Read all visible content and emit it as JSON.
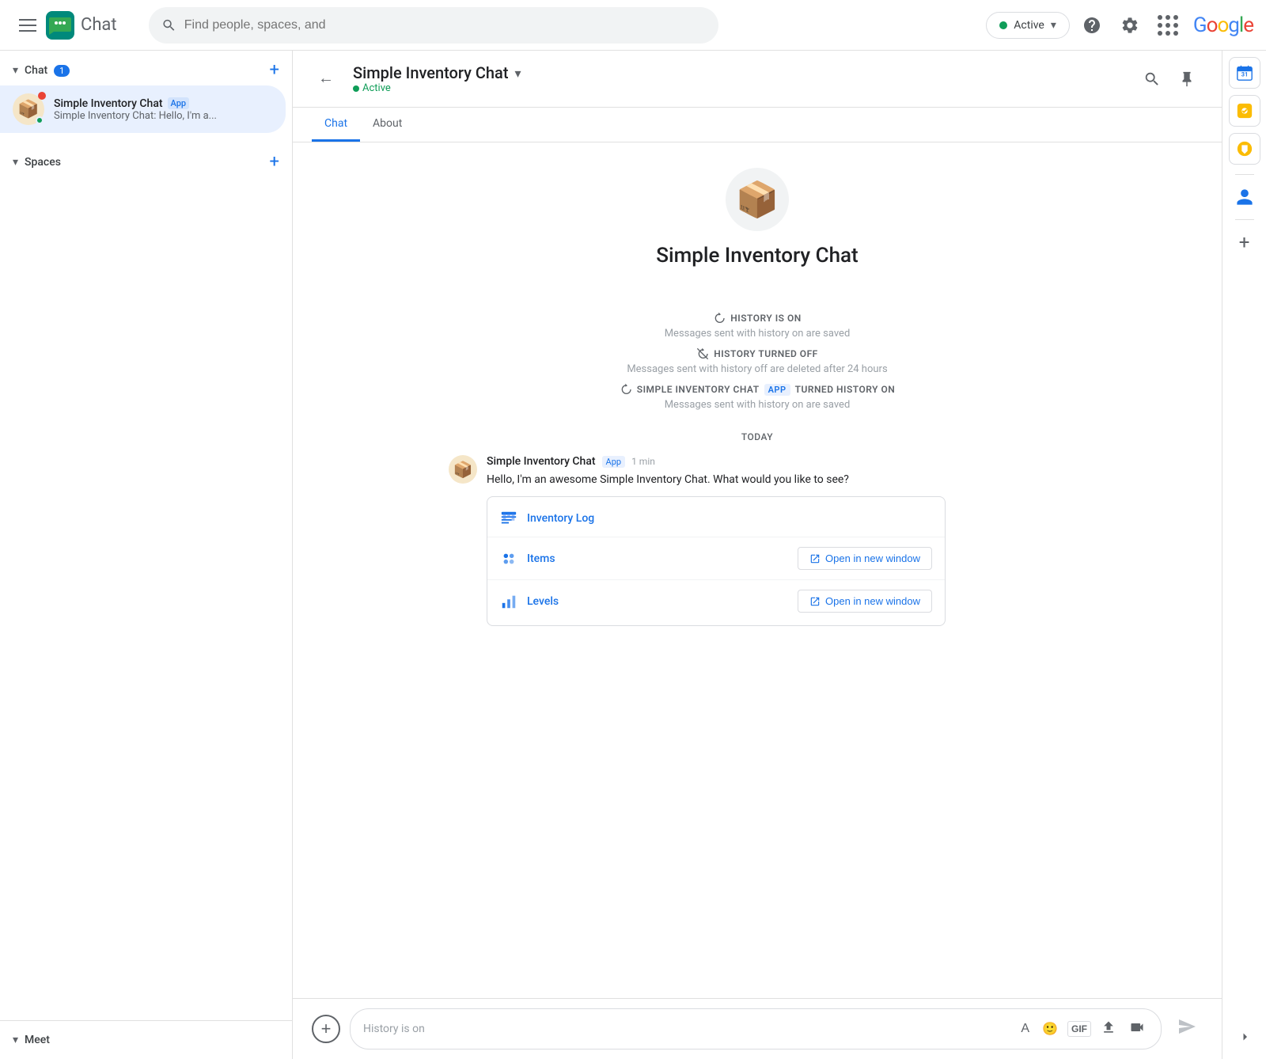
{
  "topNav": {
    "appName": "Chat",
    "search": {
      "placeholder": "Find people, spaces, and"
    },
    "activeStatus": "Active",
    "google": "Google"
  },
  "sidebar": {
    "chatSection": {
      "title": "Chat",
      "badge": "1",
      "addLabel": "+"
    },
    "chatItems": [
      {
        "name": "Simple Inventory Chat",
        "appBadge": "App",
        "preview": "Simple Inventory Chat: Hello, I'm a...",
        "hasOnline": true,
        "hasUnread": true
      }
    ],
    "spacesSection": {
      "title": "Spaces",
      "addLabel": "+"
    },
    "meetSection": {
      "title": "Meet"
    }
  },
  "chatHeader": {
    "name": "Simple Inventory Chat",
    "status": "Active",
    "tabs": [
      "Chat",
      "About"
    ],
    "activeTab": "Chat"
  },
  "chatMain": {
    "botName": "Simple Inventory Chat",
    "historyOn": {
      "title": "HISTORY IS ON",
      "subtitle": "Messages sent with history on are saved"
    },
    "historyOff": {
      "title": "HISTORY TURNED OFF",
      "subtitle": "Messages sent with history off are deleted after 24 hours"
    },
    "historyOnAgain": {
      "prefix": "SIMPLE INVENTORY CHAT",
      "appBadge": "APP",
      "suffix": "TURNED HISTORY ON",
      "subtitle": "Messages sent with history on are saved"
    },
    "todayLabel": "TODAY",
    "message": {
      "sender": "Simple Inventory Chat",
      "appBadge": "App",
      "time": "1 min",
      "text": "Hello, I'm an awesome  Simple Inventory Chat. What would you like to see?",
      "cardItems": [
        {
          "label": "Inventory Log",
          "iconType": "inventory-log",
          "hasOpenBtn": false
        },
        {
          "label": "Items",
          "iconType": "items",
          "hasOpenBtn": true,
          "openBtnText": "Open in new window"
        },
        {
          "label": "Levels",
          "iconType": "levels",
          "hasOpenBtn": true,
          "openBtnText": "Open in new window"
        }
      ]
    }
  },
  "messageInput": {
    "placeholder": "History is on"
  },
  "rightSidebar": {
    "icons": [
      {
        "name": "calendar-icon",
        "color": "#1a73e8"
      },
      {
        "name": "tasks-icon",
        "color": "#fbbc04"
      },
      {
        "name": "keep-icon",
        "color": "#34a853"
      },
      {
        "name": "contacts-icon",
        "color": "#1a73e8"
      }
    ],
    "addLabel": "+"
  }
}
